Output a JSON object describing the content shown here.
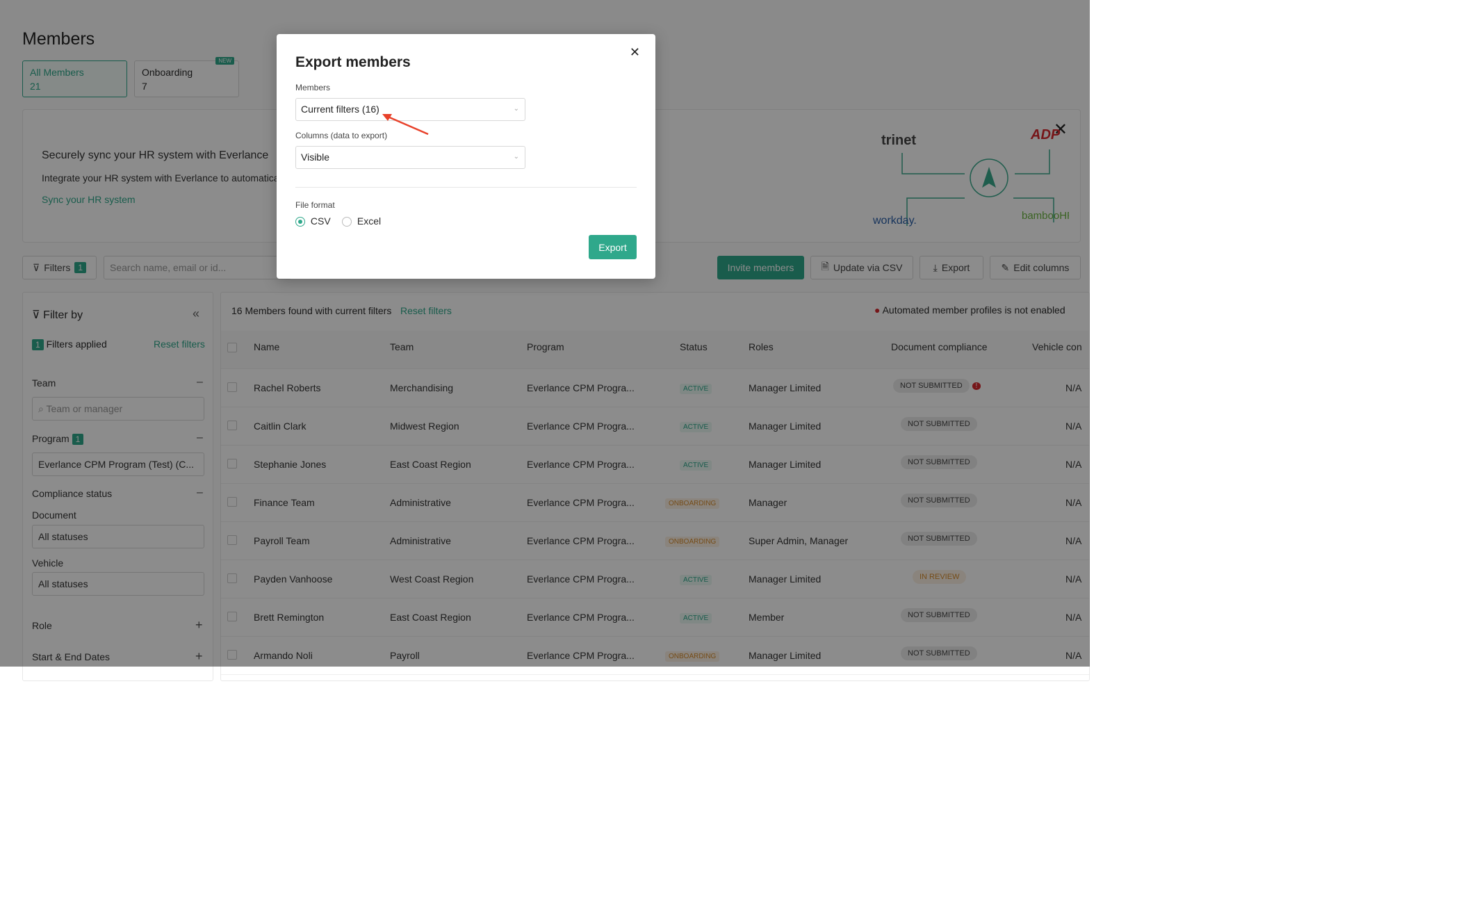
{
  "page": {
    "title": "Members",
    "tabs": [
      {
        "label": "All Members",
        "count": "21"
      },
      {
        "label": "Onboarding",
        "count": "7",
        "badge": "NEW"
      }
    ]
  },
  "banner": {
    "title": "Securely sync your HR system with Everlance",
    "text": "Integrate your HR system with Everlance to automatical",
    "link": "Sync your HR system",
    "logos": [
      "trinet",
      "ADP",
      "workday.",
      "bambooHR"
    ]
  },
  "toolbar": {
    "filters_label": "Filters",
    "filters_count": "1",
    "search_placeholder": "Search name, email or id...",
    "invite_label": "Invite members",
    "update_csv_label": "Update via CSV",
    "export_label": "Export",
    "edit_columns_label": "Edit columns"
  },
  "sidebar": {
    "title": "Filter by",
    "filters_applied_count": "1",
    "filters_applied_label": "Filters applied",
    "reset_label": "Reset filters",
    "team_label": "Team",
    "team_placeholder": "Team or manager",
    "program_label": "Program",
    "program_count": "1",
    "program_value": "Everlance CPM Program (Test) (C...",
    "compliance_label": "Compliance status",
    "document_label": "Document",
    "document_value": "All statuses",
    "vehicle_label": "Vehicle",
    "vehicle_value": "All statuses",
    "role_label": "Role",
    "dates_label": "Start & End Dates"
  },
  "table": {
    "found_text": "16 Members found with current filters",
    "reset_label": "Reset filters",
    "automated_text": "Automated member profiles is not enabled",
    "columns": [
      "Name",
      "Team",
      "Program",
      "Status",
      "Roles",
      "Document compliance",
      "Vehicle con"
    ],
    "rows": [
      {
        "name": "Rachel Roberts",
        "team": "Merchandising",
        "program": "Everlance CPM Progra...",
        "status": "ACTIVE",
        "roles": "Manager Limited",
        "doc": "NOT SUBMITTED",
        "vehicle": "N/A"
      },
      {
        "name": "Caitlin Clark",
        "team": "Midwest Region",
        "program": "Everlance CPM Progra...",
        "status": "ACTIVE",
        "roles": "Manager Limited",
        "doc": "NOT SUBMITTED",
        "vehicle": "N/A"
      },
      {
        "name": "Stephanie Jones",
        "team": "East Coast Region",
        "program": "Everlance CPM Progra...",
        "status": "ACTIVE",
        "roles": "Manager Limited",
        "doc": "NOT SUBMITTED",
        "vehicle": "N/A"
      },
      {
        "name": "Finance Team",
        "team": "Administrative",
        "program": "Everlance CPM Progra...",
        "status": "ONBOARDING",
        "roles": "Manager",
        "doc": "NOT SUBMITTED",
        "vehicle": "N/A"
      },
      {
        "name": "Payroll Team",
        "team": "Administrative",
        "program": "Everlance CPM Progra...",
        "status": "ONBOARDING",
        "roles": "Super Admin, Manager",
        "doc": "NOT SUBMITTED",
        "vehicle": "N/A"
      },
      {
        "name": "Payden Vanhoose",
        "team": "West Coast Region",
        "program": "Everlance CPM Progra...",
        "status": "ACTIVE",
        "roles": "Manager Limited",
        "doc": "IN REVIEW",
        "vehicle": "N/A"
      },
      {
        "name": "Brett Remington",
        "team": "East Coast Region",
        "program": "Everlance CPM Progra...",
        "status": "ACTIVE",
        "roles": "Member",
        "doc": "NOT SUBMITTED",
        "vehicle": "N/A"
      },
      {
        "name": "Armando Noli",
        "team": "Payroll",
        "program": "Everlance CPM Progra...",
        "status": "ONBOARDING",
        "roles": "Manager Limited",
        "doc": "NOT SUBMITTED",
        "vehicle": "N/A"
      }
    ]
  },
  "modal": {
    "title": "Export members",
    "members_label": "Members",
    "members_value": "Current filters (16)",
    "columns_label": "Columns (data to export)",
    "columns_value": "Visible",
    "format_label": "File format",
    "csv_label": "CSV",
    "excel_label": "Excel",
    "selected_format": "CSV",
    "export_label": "Export"
  },
  "colors": {
    "accent": "#2fa88b",
    "onboarding": "#d58a2b",
    "annotation_arrow": "#e8412a"
  }
}
